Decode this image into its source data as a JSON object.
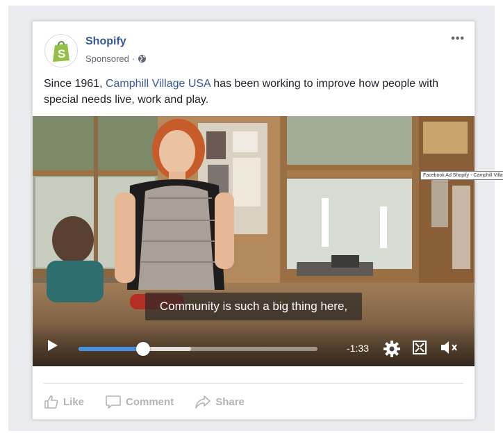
{
  "post": {
    "page_name": "Shopify",
    "sponsored_label": "Sponsored",
    "more_label": "•••",
    "text_before": "Since 1961, ",
    "text_link": "Camphill Village USA",
    "text_after": " has been working to improve how people with special needs live, work and play."
  },
  "video": {
    "caption": "Community is such a big thing here,",
    "time_remaining": "-1:33",
    "progress_fraction": 0.27,
    "buffered_fraction": 0.47,
    "tooltip": "Facebook Ad Shopify - Camphill Village"
  },
  "actions": {
    "like": "Like",
    "comment": "Comment",
    "share": "Share"
  },
  "colors": {
    "brand_green": "#95bf47",
    "link_blue": "#365899",
    "progress_blue": "#4a90e2"
  }
}
